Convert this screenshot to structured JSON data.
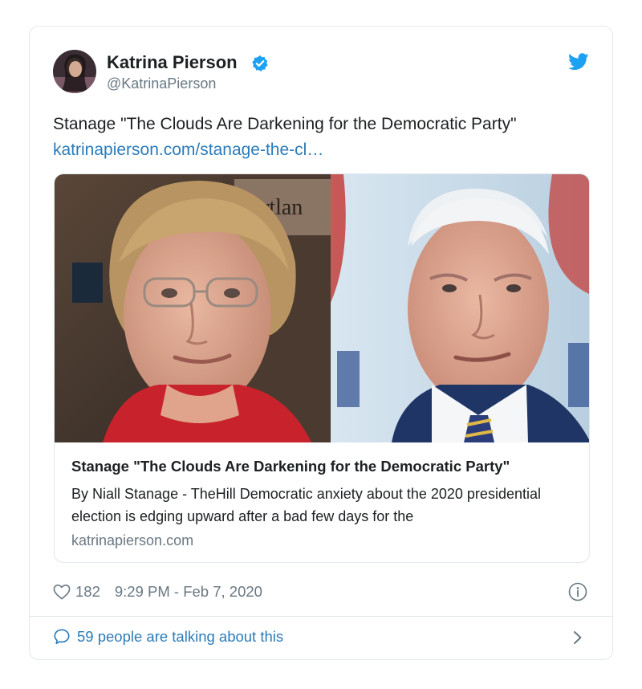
{
  "author": {
    "name": "Katrina Pierson",
    "handle": "@KatrinaPierson",
    "verified": true
  },
  "tweet": {
    "text": "Stanage \"The Clouds Are Darkening for the Democratic Party\"",
    "link": "katrinapierson.com/stanage-the-cl…"
  },
  "card": {
    "image_partial_text": "rtlan",
    "title": "Stanage \"The Clouds Are Darkening for the Democratic Party\"",
    "description": "By Niall Stanage - TheHill Democratic anxiety about the 2020 presidential election is edging upward after a bad few days for the",
    "domain": "katrinapierson.com"
  },
  "meta": {
    "likes": "182",
    "timestamp": "9:29 PM - Feb 7, 2020"
  },
  "footer": {
    "talking": "59 people are talking about this"
  },
  "icons": {
    "verified": "verified-badge-icon",
    "bird": "twitter-bird-icon",
    "heart": "heart-icon",
    "info": "info-icon",
    "comment": "speech-bubble-icon",
    "chevron": "chevron-right-icon"
  },
  "colors": {
    "link": "#2b7bb9",
    "twitter_blue": "#1da1f2",
    "muted": "#697882",
    "border": "#e1e8ed"
  }
}
